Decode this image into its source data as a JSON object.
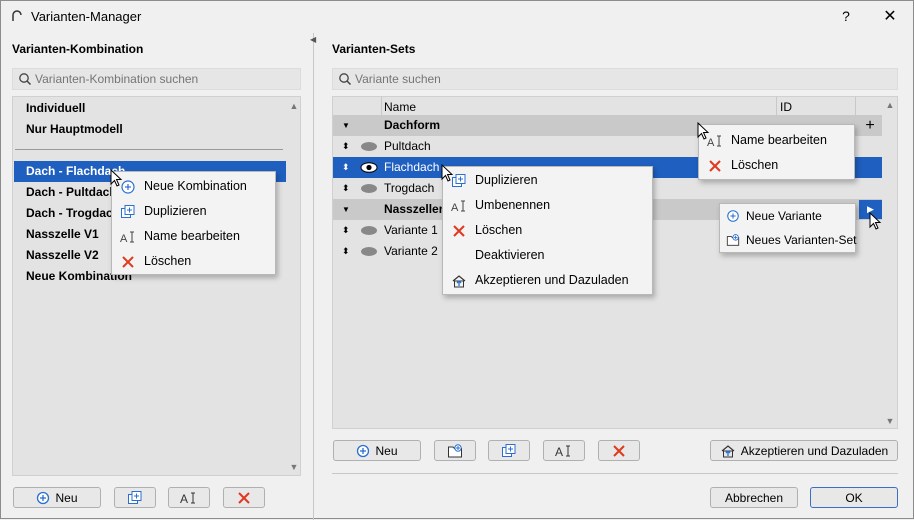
{
  "window": {
    "title": "Varianten-Manager",
    "help": "?",
    "close": "✕"
  },
  "left": {
    "title": "Varianten-Kombination",
    "search_placeholder": "Varianten-Kombination suchen",
    "items_top": [
      "Individuell",
      "Nur Hauptmodell"
    ],
    "items": [
      "Dach - Flachdach",
      "Dach - Pultdach",
      "Dach - Trogdach",
      "Nasszelle V1",
      "Nasszelle V2",
      "Neue Kombination"
    ],
    "buttons": {
      "new": "Neu"
    },
    "context_menu": [
      "Neue Kombination",
      "Duplizieren",
      "Name bearbeiten",
      "Löschen"
    ]
  },
  "right": {
    "title": "Varianten-Sets",
    "search_placeholder": "Variante suchen",
    "columns": {
      "name": "Name",
      "id": "ID"
    },
    "rows": [
      {
        "label": "Dachform",
        "type": "group"
      },
      {
        "label": "Pultdach",
        "type": "item"
      },
      {
        "label": "Flachdach",
        "type": "item-selected"
      },
      {
        "label": "Trogdach",
        "type": "item"
      },
      {
        "label": "Nasszellen",
        "type": "group"
      },
      {
        "label": "Variante 1",
        "type": "item"
      },
      {
        "label": "Variante 2",
        "type": "item"
      }
    ],
    "add_symbol": "+",
    "buttons": {
      "new": "Neu",
      "accept": "Akzeptieren und Dazuladen"
    },
    "context_menu": [
      "Duplizieren",
      "Umbenennen",
      "Löschen",
      "Deaktivieren",
      "Akzeptieren und Dazuladen"
    ],
    "group_menu": [
      "Name bearbeiten",
      "Löschen"
    ],
    "add_menu": [
      "Neue Variante",
      "Neues Varianten-Set"
    ]
  },
  "footer": {
    "cancel": "Abbrechen",
    "ok": "OK"
  },
  "colors": {
    "selection": "#1f5fbf",
    "delete_red": "#e03a1e",
    "icon_blue": "#2a6fd1"
  }
}
